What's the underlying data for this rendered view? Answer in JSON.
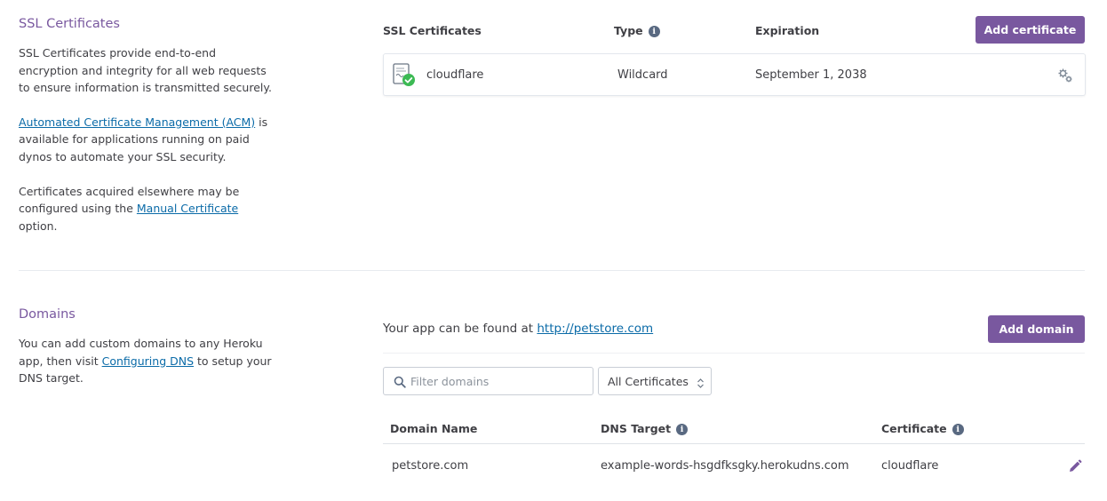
{
  "ssl": {
    "title": "SSL Certificates",
    "desc_p1": "SSL Certificates provide end-to-end encryption and integrity for all web requests to ensure information is transmitted securely.",
    "desc_p2_link": "Automated Certificate Management (ACM)",
    "desc_p2_rest": " is available for applications running on paid dynos to automate your SSL security.",
    "desc_p3_pre": "Certificates acquired elsewhere may be configured using the ",
    "desc_p3_link": "Manual Certificate",
    "desc_p3_post": "option.",
    "table": {
      "col_name": "SSL Certificates",
      "col_type": "Type",
      "col_expiration": "Expiration",
      "add_button": "Add certificate",
      "rows": [
        {
          "name": "cloudflare",
          "type": "Wildcard",
          "expiration": "September 1, 2038"
        }
      ]
    }
  },
  "domains": {
    "title": "Domains",
    "desc_pre": "You can add custom domains to any Heroku app, then visit ",
    "desc_link": "Configuring DNS",
    "desc_post": " to setup your DNS target.",
    "found_at_text": "Your app can be found at ",
    "found_at_link": "http://petstore.com",
    "add_button": "Add domain",
    "filter_placeholder": "Filter domains",
    "certificate_filter": "All Certificates",
    "table": {
      "col_domain": "Domain Name",
      "col_dns": "DNS Target",
      "col_certificate": "Certificate",
      "rows": [
        {
          "domain": "petstore.com",
          "dns_target": "example-words-hsgdfksgky.herokudns.com",
          "certificate": "cloudflare"
        }
      ]
    }
  },
  "colors": {
    "accent": "#79589f",
    "link": "#0b6ba8",
    "success": "#3cba54"
  },
  "icons": {
    "info": "info-icon",
    "cert": "certificate-check-icon",
    "gear": "gears-icon",
    "search": "search-icon",
    "edit": "pencil-icon",
    "select": "chevron-updown-icon"
  }
}
